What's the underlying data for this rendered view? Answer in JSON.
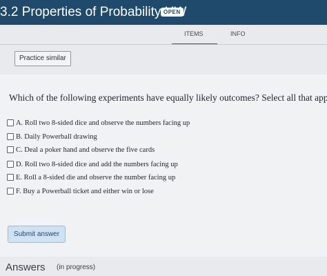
{
  "header": {
    "title": "3.2 Properties of Probability HW",
    "badge": "OPEN"
  },
  "tabs": [
    {
      "label": "ITEMS",
      "active": true
    },
    {
      "label": "INFO",
      "active": false
    }
  ],
  "practice_button": "Practice similar",
  "question": {
    "prompt": "Which of the following experiments have equally likely outcomes? Select all that apply.",
    "options": [
      {
        "label": "A. Roll two 8-sided dice and observe the numbers facing up",
        "checked": false
      },
      {
        "label": "B. Daily Powerball drawing",
        "checked": false
      },
      {
        "label": "C. Deal a poker hand and observe the five cards",
        "checked": false
      },
      {
        "label": "D. Roll two 8-sided dice and add the numbers facing up",
        "checked": false
      },
      {
        "label": "E. Roll a 8-sided die and observe the number facing up",
        "checked": false
      },
      {
        "label": "F. Buy a Powerball ticket and either win or lose",
        "checked": false
      }
    ]
  },
  "submit_button": "Submit answer",
  "answers": {
    "title": "Answers",
    "status": "(in progress)"
  },
  "colors": {
    "header_bg": "#1f4a6b",
    "submit_bg": "#cfe2f3",
    "page_bg": "#e9eaee"
  }
}
